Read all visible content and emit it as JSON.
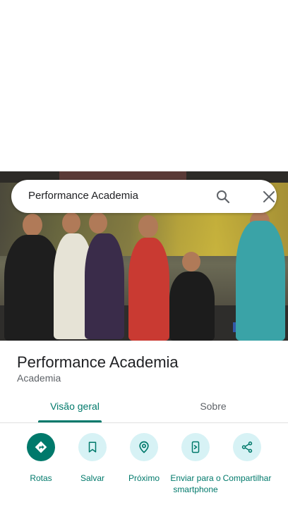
{
  "search": {
    "query": "Performance Academia"
  },
  "place": {
    "name": "Performance Academia",
    "category": "Academia"
  },
  "tabs": [
    {
      "label": "Visão geral",
      "active": true
    },
    {
      "label": "Sobre",
      "active": false
    }
  ],
  "actions": [
    {
      "label": "Rotas",
      "icon": "directions-icon"
    },
    {
      "label": "Salvar",
      "icon": "bookmark-icon"
    },
    {
      "label": "Próximo",
      "icon": "nearby-icon"
    },
    {
      "label": "Enviar para o smartphone",
      "icon": "send-to-phone-icon"
    },
    {
      "label": "Compartilhar",
      "icon": "share-icon"
    }
  ],
  "colors": {
    "accent": "#00796b",
    "chip": "#d7f2f5",
    "text": "#202124",
    "secondary": "#5f6368"
  }
}
